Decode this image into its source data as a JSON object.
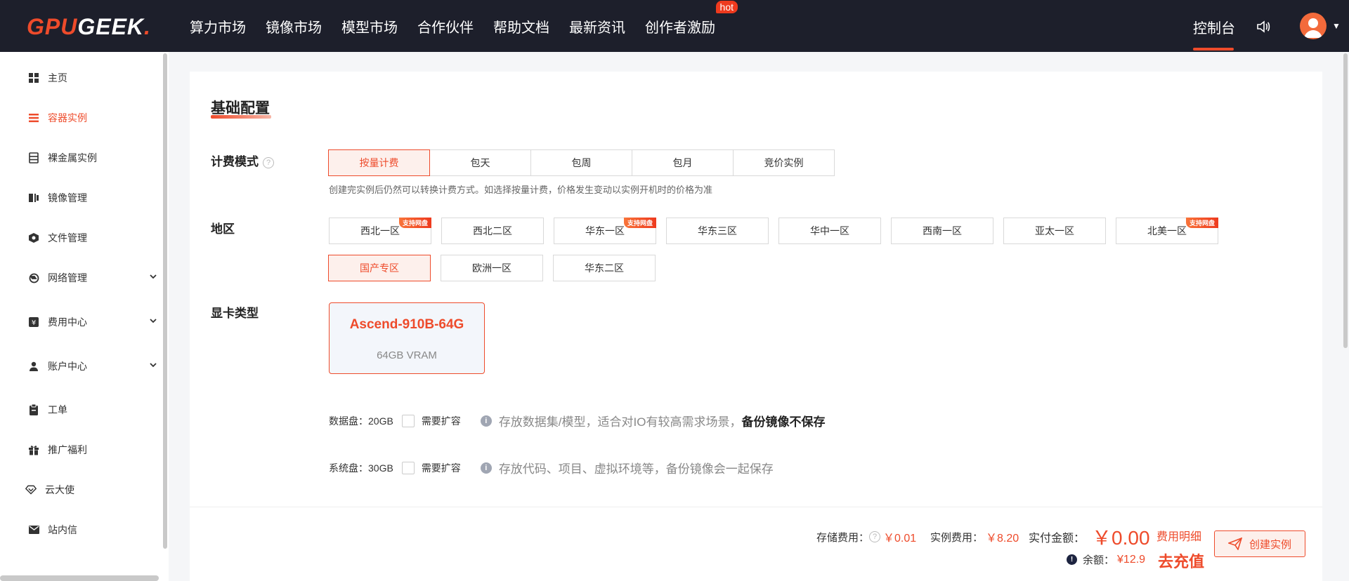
{
  "brand": {
    "logo_part1": "GPU",
    "logo_part2": "GEEK",
    "logo_dot": "."
  },
  "nav": {
    "items": [
      "算力市场",
      "镜像市场",
      "模型市场",
      "合作伙伴",
      "帮助文档",
      "最新资讯",
      "创作者激励"
    ],
    "hot_badge": "hot",
    "console": "控制台"
  },
  "sidebar": {
    "items": [
      {
        "label": "主页",
        "icon": "grid-icon"
      },
      {
        "label": "容器实例",
        "icon": "list-icon",
        "active": true
      },
      {
        "label": "裸金属实例",
        "icon": "server-icon"
      },
      {
        "label": "镜像管理",
        "icon": "image-icon"
      },
      {
        "label": "文件管理",
        "icon": "file-icon"
      },
      {
        "label": "网络管理",
        "icon": "network-icon",
        "expandable": true
      },
      {
        "label": "费用中心",
        "icon": "yen-icon",
        "expandable": true
      },
      {
        "label": "账户中心",
        "icon": "user-icon",
        "expandable": true
      },
      {
        "label": "工单",
        "icon": "clipboard-icon"
      },
      {
        "label": "推广福利",
        "icon": "gift-icon"
      },
      {
        "label": "云大使",
        "icon": "diamond-icon"
      },
      {
        "label": "站内信",
        "icon": "mail-icon"
      }
    ]
  },
  "config": {
    "title": "基础配置",
    "billing": {
      "label": "计费模式",
      "help": "?",
      "options": [
        "按量计费",
        "包天",
        "包周",
        "包月",
        "竞价实例"
      ],
      "selected": "按量计费",
      "note": "创建完实例后仍然可以转换计费方式。如选择按量计费，价格发生变动以实例开机时的价格为准"
    },
    "region": {
      "label": "地区",
      "badge": "支持网盘",
      "options": [
        "西北一区",
        "西北二区",
        "华东一区",
        "华东三区",
        "华中一区",
        "西南一区",
        "亚太一区",
        "北美一区",
        "国产专区",
        "欧洲一区",
        "华东二区"
      ],
      "selected": "国产专区"
    },
    "gpu": {
      "label": "显卡类型",
      "name": "Ascend-910B-64G",
      "vram": "64GB VRAM"
    },
    "data_disk": {
      "label": "数据盘：20GB",
      "expand": "需要扩容",
      "note": "存放数据集/模型，适合对IO有较高需求场景，",
      "note_bold": "备份镜像不保存"
    },
    "system_disk": {
      "label": "系统盘：30GB",
      "expand": "需要扩容",
      "note": "存放代码、项目、虚拟环境等，备份镜像会一起保存"
    }
  },
  "footer": {
    "storage_label": "存储费用：",
    "storage_val": "￥0.01",
    "instance_label": "实例费用：",
    "instance_val": "￥8.20",
    "total_label": "实付金额：",
    "total_val": "￥0.00",
    "detail": "费用明细",
    "balance_label": "余额：",
    "balance_val": "¥12.9",
    "recharge": "去充值",
    "create": "创建实例"
  },
  "colors": {
    "accent": "#ee4b2b",
    "nav_bg": "#1d1f2b"
  }
}
